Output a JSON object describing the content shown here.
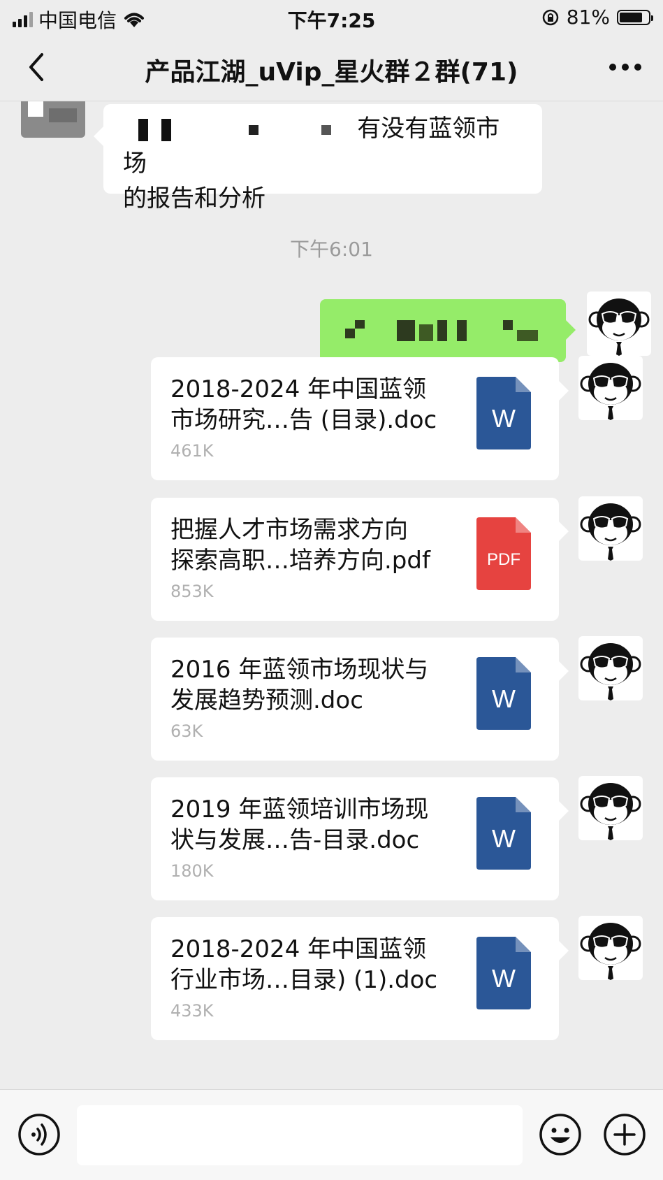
{
  "status_bar": {
    "carrier": "中国电信",
    "time": "下午7:25",
    "battery_percent": "81%",
    "battery_level": 0.81,
    "icons": [
      "signal-icon",
      "wifi-icon",
      "rotation-lock-icon",
      "battery-icon"
    ]
  },
  "nav": {
    "title": "产品江湖_uVip_星火群２群(71)",
    "back_icon": "back-arrow-icon",
    "more_icon": "more-dots-icon"
  },
  "messages": {
    "incoming_text": "有没有蓝领市场的报告和分析",
    "incoming_visible_tail": "有没有蓝领市场",
    "incoming_line2": "的报告和分析",
    "timestamp": "下午6:01"
  },
  "files": [
    {
      "name": "2018-2024 年中国蓝领\n市场研究…告 (目录).doc",
      "size": "461K",
      "type": "word",
      "icon_label": "W",
      "icon_color": "#2b5797"
    },
    {
      "name": "把握人才市场需求方向\n探索高职…培养方向.pdf",
      "size": "853K",
      "type": "pdf",
      "icon_label": "PDF",
      "icon_color": "#e64340"
    },
    {
      "name": "2016 年蓝领市场现状与\n发展趋势预测.doc",
      "size": "63K",
      "type": "word",
      "icon_label": "W",
      "icon_color": "#2b5797"
    },
    {
      "name": "2019 年蓝领培训市场现\n状与发展…告-目录.doc",
      "size": "180K",
      "type": "word",
      "icon_label": "W",
      "icon_color": "#2b5797"
    },
    {
      "name": "2018-2024 年中国蓝领\n行业市场…目录) (1).doc",
      "size": "433K",
      "type": "word",
      "icon_label": "W",
      "icon_color": "#2b5797"
    }
  ],
  "input_bar": {
    "value": "",
    "icons": [
      "voice-icon",
      "emoji-icon",
      "plus-icon"
    ]
  },
  "colors": {
    "background": "#ededed",
    "sent_bubble": "#95ec69",
    "word_blue": "#2b5797",
    "pdf_red": "#e64340"
  }
}
